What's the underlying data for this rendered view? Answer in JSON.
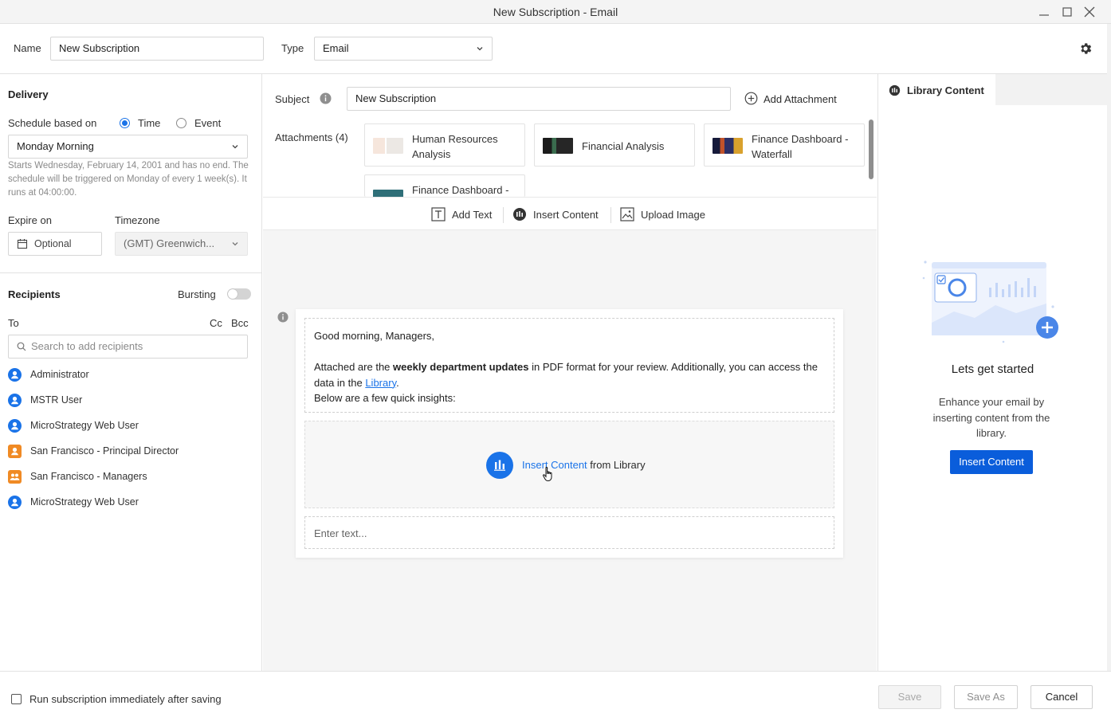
{
  "window": {
    "title": "New Subscription - Email"
  },
  "header": {
    "name_label": "Name",
    "name_value": "New Subscription",
    "type_label": "Type",
    "type_value": "Email"
  },
  "delivery": {
    "title": "Delivery",
    "schedule_label": "Schedule based on",
    "option_time": "Time",
    "option_event": "Event",
    "schedule_value": "Monday Morning",
    "schedule_hint": "Starts Wednesday, February 14, 2001 and has no end. The schedule will be triggered on Monday of every 1 week(s). It runs at 04:00:00.",
    "expire_label": "Expire on",
    "expire_placeholder": "Optional",
    "timezone_label": "Timezone",
    "timezone_value": "(GMT) Greenwich..."
  },
  "recipients": {
    "title": "Recipients",
    "bursting_label": "Bursting",
    "to_label": "To",
    "cc_label": "Cc",
    "bcc_label": "Bcc",
    "search_placeholder": "Search to add recipients",
    "items": [
      {
        "name": "Administrator",
        "kind": "user"
      },
      {
        "name": "MSTR User",
        "kind": "user"
      },
      {
        "name": "MicroStrategy Web User",
        "kind": "user"
      },
      {
        "name": "San Francisco - Principal Director",
        "kind": "contact"
      },
      {
        "name": "San Francisco - Managers",
        "kind": "group"
      },
      {
        "name": "MicroStrategy Web User",
        "kind": "user"
      }
    ]
  },
  "email": {
    "subject_label": "Subject",
    "subject_value": "New Subscription",
    "add_attachment": "Add Attachment",
    "attachments_label": "Attachments (4)",
    "attachments": [
      {
        "title": "Human Resources Analysis"
      },
      {
        "title": "Financial Analysis"
      },
      {
        "title": "Finance Dashboard - Waterfall"
      },
      {
        "title": "Finance Dashboard -"
      }
    ],
    "toolbar": {
      "add_text": "Add Text",
      "insert_content": "Insert Content",
      "upload_image": "Upload Image"
    },
    "body": {
      "greeting": "Good morning, Managers,",
      "line1_a": "Attached are the ",
      "line1_bold": "weekly department updates",
      "line1_b": " in PDF format for your review. Additionally, you can access the data in the ",
      "line1_link": "Library",
      "line1_c": ".",
      "line2": "Below are a few quick insights:",
      "insert_link": "Insert Content",
      "insert_suffix": " from Library",
      "text_placeholder": "Enter text..."
    }
  },
  "library_panel": {
    "tab_label": "Library Content",
    "heading": "Lets get started",
    "description": "Enhance your email by inserting content from the library.",
    "button": "Insert Content"
  },
  "footer": {
    "run_immediately": "Run subscription immediately after saving",
    "save": "Save",
    "save_as": "Save As",
    "cancel": "Cancel"
  },
  "colors": {
    "accent": "#1a73e8",
    "primary_button": "#0a5ddb",
    "contact_orange": "#f08a24"
  }
}
